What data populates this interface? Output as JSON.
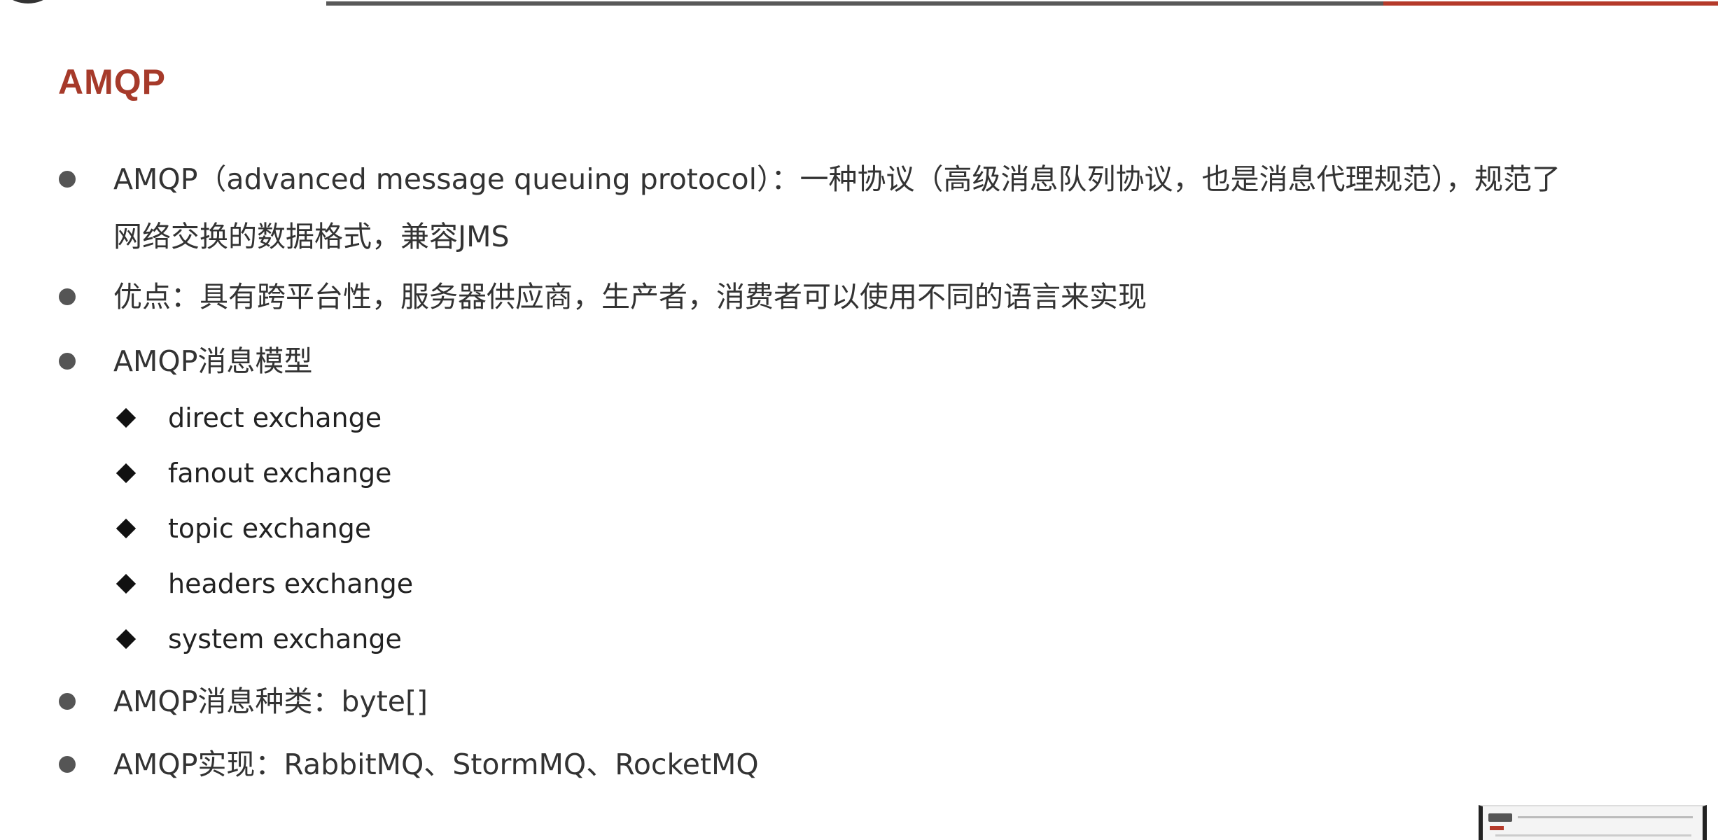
{
  "slide": {
    "title": "AMQP",
    "bullets": {
      "b1_line1": "AMQP（advanced message queuing protocol）：一种协议（高级消息队列协议，也是消息代理规范），规范了",
      "b1_line2": "网络交换的数据格式，兼容JMS",
      "b2": "优点：具有跨平台性，服务器供应商，生产者，消费者可以使用不同的语言来实现",
      "b3": "AMQP消息模型",
      "b4": "AMQP消息种类：byte[]",
      "b5": "AMQP实现：RabbitMQ、StormMQ、RocketMQ"
    },
    "sub_items": [
      "direct exchange",
      "fanout exchange",
      "topic exchange",
      "headers exchange",
      "system exchange"
    ]
  },
  "colors": {
    "title": "#a63a2a",
    "accent_bar": "#b53a2a",
    "text": "#333333"
  }
}
